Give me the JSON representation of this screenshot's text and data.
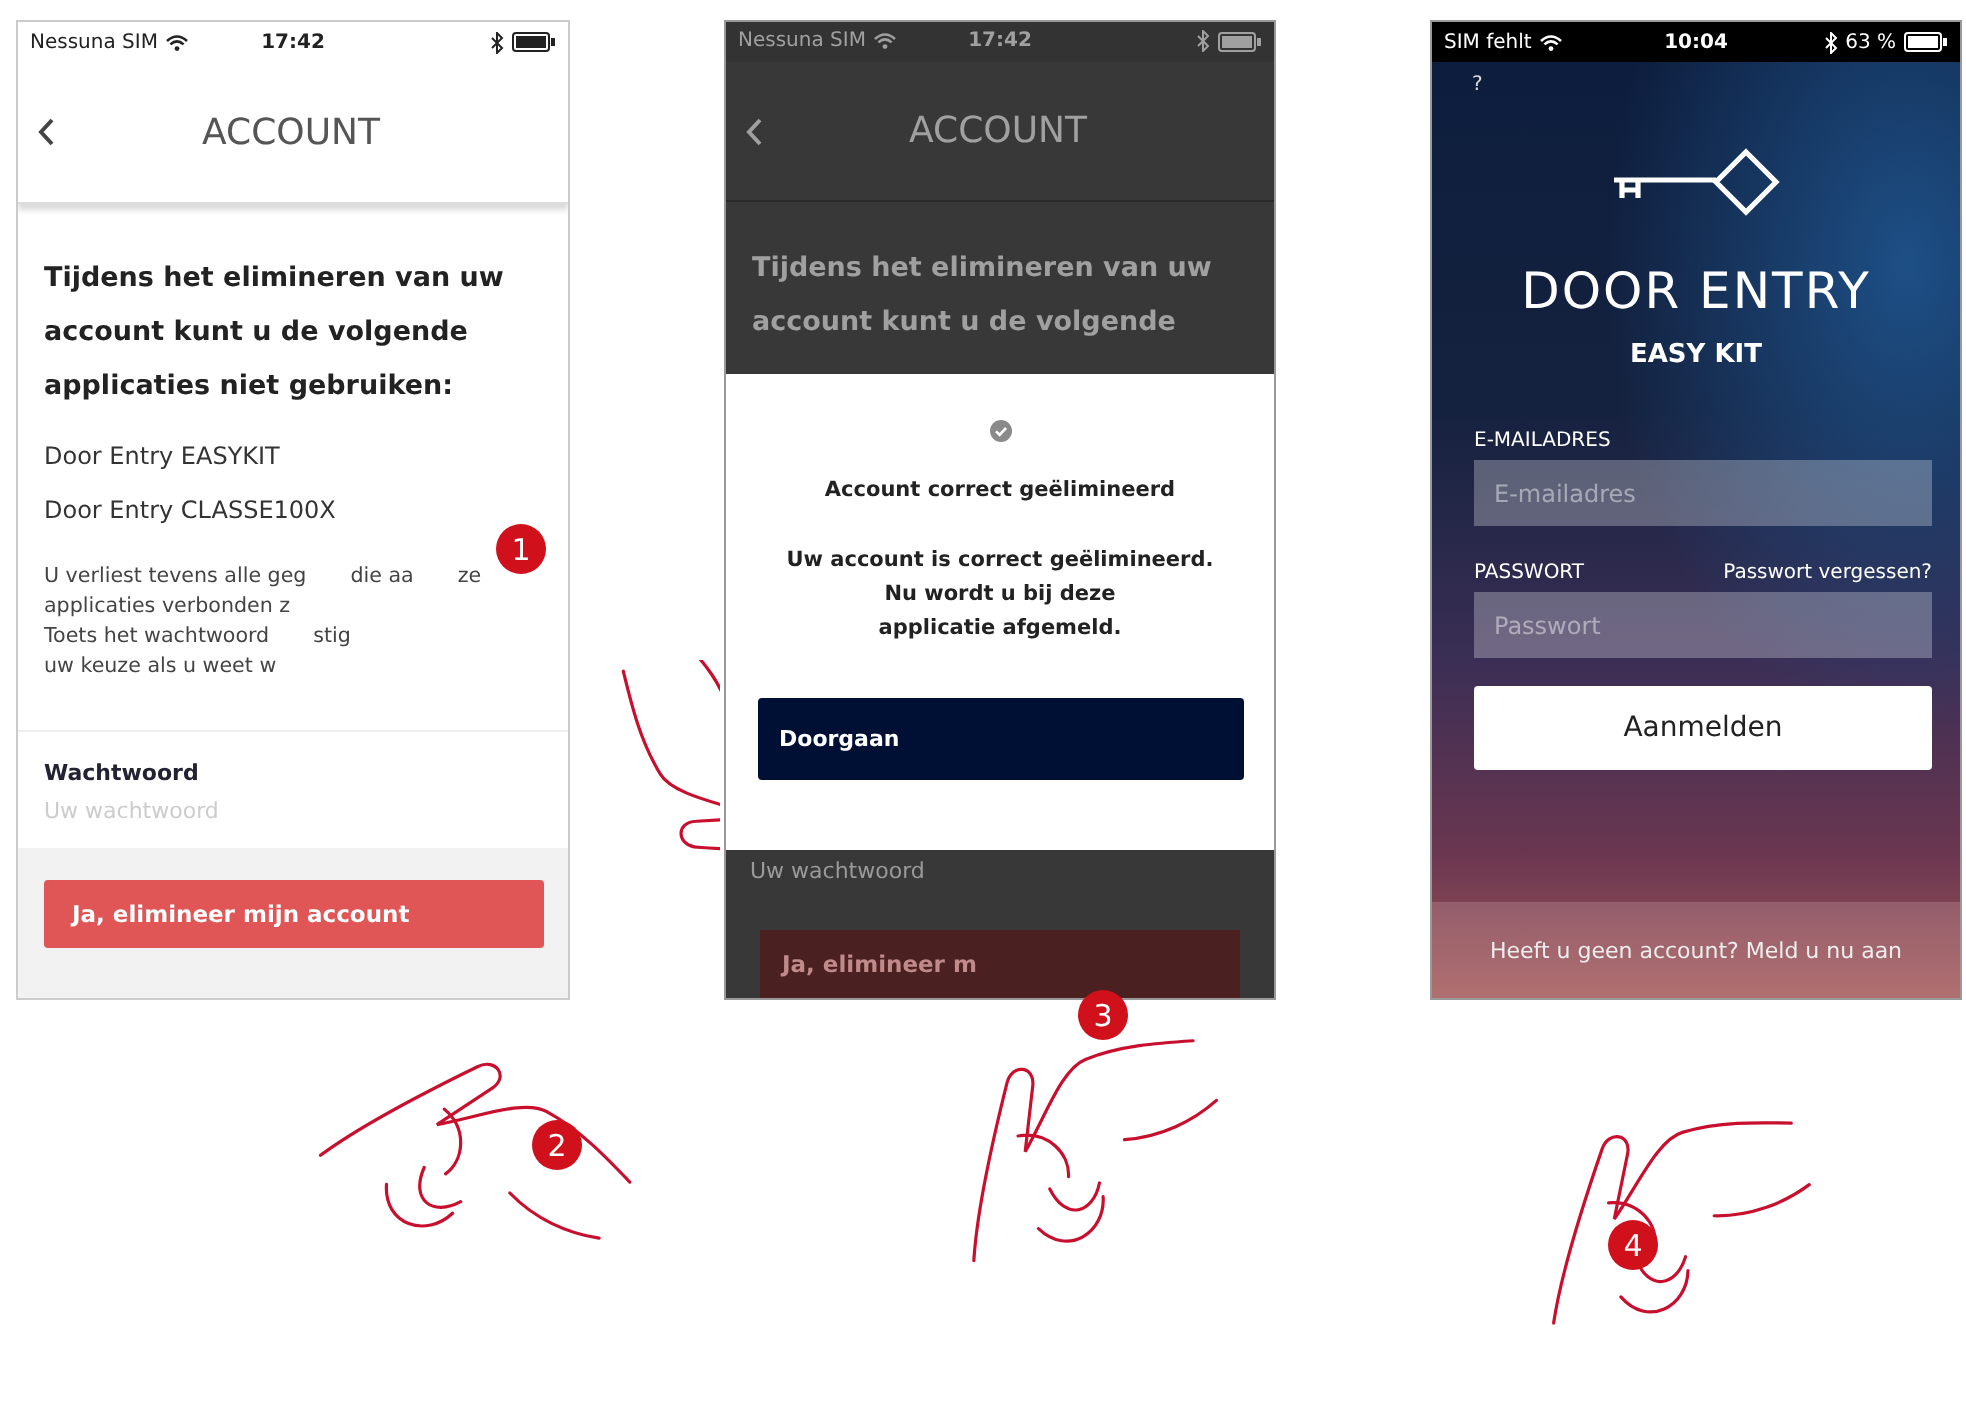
{
  "screens": [
    {
      "kind": "account",
      "status_bar": {
        "carrier": "Nessuna SIM",
        "time": "17:42"
      },
      "title": "ACCOUNT",
      "heading": "Tijdens het elimineren van uw account kunt u de volgende applicaties niet gebruiken:",
      "apps": [
        "Door Entry EASYKIT",
        "Door Entry CLASSE100X"
      ],
      "notice_lines": [
        [
          "U verliest tevens alle geg",
          "die aa",
          "ze"
        ],
        [
          "applicaties verbonden z"
        ],
        [
          "Toets het wachtwoord",
          "stig"
        ],
        [
          "uw keuze als u weet w"
        ]
      ],
      "password": {
        "label": "Wachtwoord",
        "placeholder": "Uw wachtwoord"
      },
      "delete_button": "Ja, elimineer mijn account"
    },
    {
      "kind": "dialog",
      "status_bar": {
        "carrier": "Nessuna SIM",
        "time": "17:42"
      },
      "title": "ACCOUNT",
      "heading_lines": [
        "Tijdens het elimineren van uw",
        "account kunt u de volgende"
      ],
      "behind_field_placeholder": "Uw wachtwoord",
      "behind_button": "Ja, elimineer m",
      "dialog": {
        "title": "Account correct geëlimineerd",
        "message_lines": [
          "Uw account is correct geëlimineerd.",
          "Nu wordt u bij deze",
          "applicatie afgemeld."
        ],
        "button": "Doorgaan"
      }
    },
    {
      "kind": "login",
      "status_bar": {
        "carrier": "SIM fehlt",
        "time": "10:04",
        "battery": "63 %"
      },
      "help": "?",
      "app_title": "DOOR ENTRY",
      "app_subtitle": "EASY KIT",
      "email": {
        "label": "E-MAILADRES",
        "placeholder": "E-mailadres"
      },
      "password": {
        "label": "PASSWORT",
        "placeholder": "Passwort",
        "forgot": "Passwort vergessen?"
      },
      "login_button": "Aanmelden",
      "signup": "Heeft u geen account? Meld u nu aan"
    }
  ],
  "steps": [
    "1",
    "2",
    "3",
    "4"
  ]
}
